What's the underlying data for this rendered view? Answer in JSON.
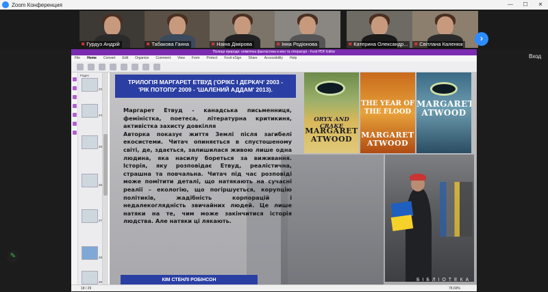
{
  "window": {
    "title": "Zoom Конференция",
    "min": "—",
    "max": "☐",
    "close": "✕"
  },
  "participants": [
    {
      "name": "Гурдуз Андрій",
      "muted": true
    },
    {
      "name": "Табакова Ганна",
      "muted": true
    },
    {
      "name": "Наіна Дімірова",
      "muted": true
    },
    {
      "name": "Інна Родіонова",
      "muted": true
    },
    {
      "name": "Катерина Олександр...",
      "muted": true
    },
    {
      "name": "Світлана Каленюк",
      "muted": true
    }
  ],
  "next_participants_icon": "›",
  "side_label": "Вход",
  "pen_icon": "✎",
  "pdf": {
    "title": "Полиця природи: олімпічна фантастика в кіно та літературі - Foxit PDF Editor",
    "menu": [
      "File",
      "Home",
      "Convert",
      "Edit",
      "Organize",
      "Comment",
      "View",
      "Form",
      "Protect",
      "Foxit eSign",
      "Share",
      "Accessibility",
      "Help"
    ],
    "active_menu": "Home",
    "thumbs_header": "Pages",
    "thumb_numbers": [
      "23",
      "24",
      "25",
      "26",
      "27",
      "28",
      "29"
    ],
    "status_page": "18 / 29",
    "status_zoom": "78.69%"
  },
  "slide": {
    "title_line1": "ТРИЛОГІЯ МАРГАРЕТ ЕТВУД ('ОРІКС І ДЕРКАЧ' 2003 -",
    "title_line2": "'РІК ПОТОПУ' 2009 - 'ШАЛЕНИЙ АДДАМ' 2013).",
    "paragraph1": "Маргарет Етвуд - канадська письменниця, феміністка, поетеса, літературна критикиня, активістка захисту довкілля",
    "paragraph2": "Авторка показує життя Землі після загибелі екосистеми. Читач опиняється в спустошеному світі, де, здається, залишилася живою лише одна людина, яка насилу бореться за виживання. Історія, яку розповідає Етвуд, реалістична, страшна та повчальна. Читач під час розповіді може помітити деталі, що натякають на сучасні реалії – екологію, що погіршується, корупцію політиків, жадібність корпорацій і недалекоглядність звичайних людей. Це лише натяки на те, чим може закінчитися історія людства. Але натяки ці лякають.",
    "bottom_heading": "КІМ СТЕНЛІ РОБІНСОН",
    "bottom_faint": "Б І Б Л І О Т Е К А"
  },
  "books": [
    {
      "title": "ORYX AND CRAKE",
      "author": "MARGARET ATWOOD"
    },
    {
      "title": "THE YEAR OF THE FLOOD",
      "author": "MARGARET ATWOOD"
    },
    {
      "title": "",
      "author": "MARGARET ATWOOD"
    }
  ]
}
